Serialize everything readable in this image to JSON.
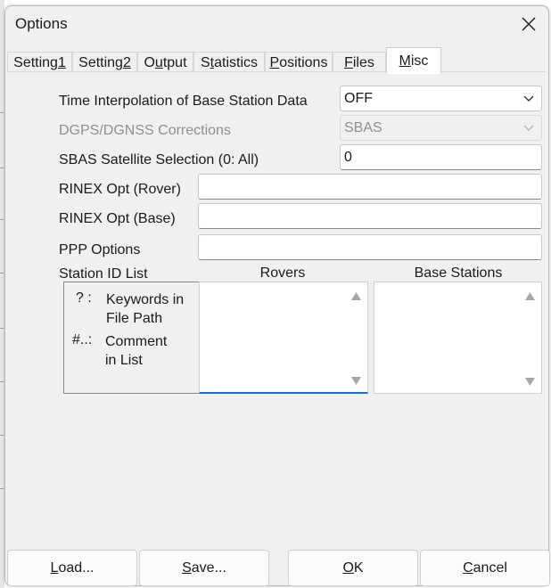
{
  "window": {
    "title": "Options"
  },
  "tabs": [
    {
      "pre": "Setting",
      "ul": "1",
      "post": ""
    },
    {
      "pre": "Setting",
      "ul": "2",
      "post": ""
    },
    {
      "pre": "O",
      "ul": "u",
      "post": "tput"
    },
    {
      "pre": "S",
      "ul": "t",
      "post": "atistics"
    },
    {
      "pre": "",
      "ul": "P",
      "post": "ositions"
    },
    {
      "pre": "",
      "ul": "F",
      "post": "iles"
    },
    {
      "pre": "",
      "ul": "M",
      "post": "isc"
    }
  ],
  "active_tab": "Misc",
  "form": {
    "time_interp": {
      "label": "Time Interpolation of Base Station Data",
      "value": "OFF"
    },
    "dgps": {
      "label": "DGPS/DGNSS Corrections",
      "value": "SBAS"
    },
    "sbas_sel": {
      "label": "SBAS Satellite Selection (0: All)",
      "value": "0"
    },
    "rinex_rover": {
      "label": "RINEX Opt (Rover)",
      "value": ""
    },
    "rinex_base": {
      "label": "RINEX Opt (Base)",
      "value": ""
    },
    "ppp": {
      "label": "PPP Options",
      "value": ""
    }
  },
  "station_list": {
    "label": "Station ID List",
    "rovers_header": "Rovers",
    "base_header": "Base Stations",
    "hint1_key": "? :",
    "hint1_line1": "Keywords in",
    "hint1_line2": "File Path",
    "hint2_key": "#..:",
    "hint2_line1": "Comment",
    "hint2_line2": "in List"
  },
  "buttons": {
    "load": {
      "ul": "L",
      "rest": "oad..."
    },
    "save": {
      "ul": "S",
      "rest": "ave..."
    },
    "ok": {
      "ul": "O",
      "rest": "K"
    },
    "cancel": {
      "ul": "C",
      "rest": "ancel"
    }
  },
  "colors": {
    "focus_blue": "#1a6fd0",
    "disabled_text": "#8f8f8f"
  }
}
